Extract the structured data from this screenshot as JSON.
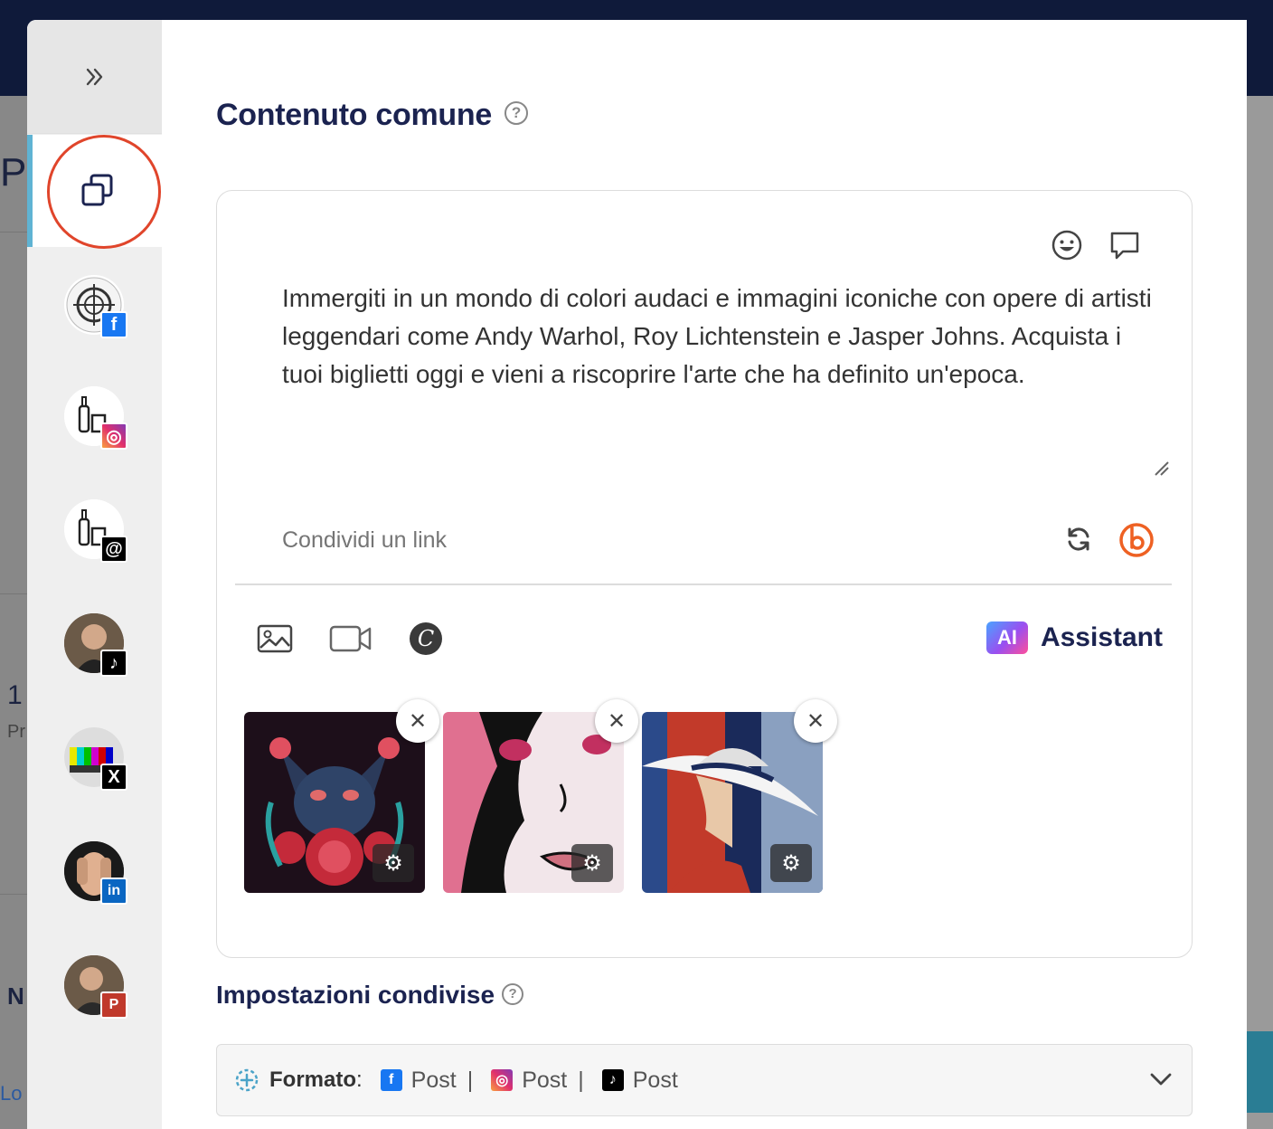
{
  "background": {
    "left_letters": [
      "P",
      "1",
      "Pr",
      "N",
      "Lo"
    ]
  },
  "sidebar": {
    "collapse_icon": "double-chevron-right-icon",
    "common_content_icon": "copy-icon",
    "accounts": [
      {
        "name": "account-1",
        "network": "facebook",
        "badge": "f",
        "color": "#1877f2"
      },
      {
        "name": "account-2",
        "network": "instagram",
        "badge": "◎",
        "color": "#e1306c"
      },
      {
        "name": "account-3",
        "network": "threads",
        "badge": "@",
        "color": "#000000"
      },
      {
        "name": "account-4",
        "network": "tiktok",
        "badge": "♪",
        "color": "#000000"
      },
      {
        "name": "account-5",
        "network": "x",
        "badge": "X",
        "color": "#000000"
      },
      {
        "name": "account-6",
        "network": "linkedin",
        "badge": "in",
        "color": "#0a66c2"
      },
      {
        "name": "account-7",
        "network": "pinterest",
        "badge": "P",
        "color": "#c0392b"
      }
    ]
  },
  "main": {
    "title": "Contenuto comune",
    "help": "?",
    "post_text": "Immergiti in un mondo di colori audaci e immagini iconiche con opere di artisti leggendari come Andy Warhol, Roy Lichtenstein e Jasper Johns. Acquista i tuoi biglietti oggi e vieni a riscoprire l'arte che ha definito un'epoca.",
    "link_placeholder": "Condividi un link",
    "ai": {
      "badge": "AI",
      "label": "Assistant"
    },
    "media": [
      {
        "name": "cat-flowers-image",
        "remove": "✕",
        "settings": "⚙"
      },
      {
        "name": "pop-art-face-image",
        "remove": "✕",
        "settings": "⚙"
      },
      {
        "name": "woman-hat-image",
        "remove": "✕",
        "settings": "⚙"
      }
    ],
    "shared_settings_title": "Impostazioni condivise",
    "format": {
      "label": "Formato",
      "colon": ":",
      "items": [
        {
          "network": "facebook",
          "value": "Post",
          "icon_char": "f",
          "color": "#1877f2"
        },
        {
          "network": "instagram",
          "value": "Post",
          "icon_char": "◎",
          "color": "#e1306c"
        },
        {
          "network": "tiktok",
          "value": "Post",
          "icon_char": "♪",
          "color": "#000000"
        }
      ],
      "separator": "|"
    }
  },
  "colors": {
    "accent": "#5fb3d3",
    "title": "#1b2350",
    "highlight_ring": "#e0452b",
    "bitly": "#ee6123"
  }
}
